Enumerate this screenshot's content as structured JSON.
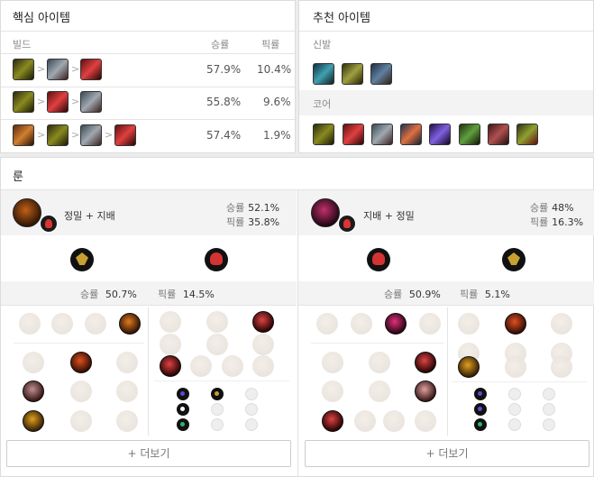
{
  "core": {
    "title": "핵심 아이템",
    "headers": {
      "build": "빌드",
      "winrate": "승률",
      "pickrate": "픽률"
    },
    "rows": [
      {
        "winrate": "57.9%",
        "pickrate": "10.4%"
      },
      {
        "winrate": "55.8%",
        "pickrate": "9.6%"
      },
      {
        "winrate": "57.4%",
        "pickrate": "1.9%"
      }
    ],
    "arrow": ">"
  },
  "recommended": {
    "title": "추천 아이템",
    "boots_label": "신발",
    "core_label": "코어"
  },
  "runes": {
    "title": "룬",
    "pages": [
      {
        "name": "정밀 + 지배",
        "winrate_label": "승률",
        "winrate": "52.1%",
        "pickrate_label": "픽률",
        "pickrate": "35.8%",
        "detail_winrate_label": "승률",
        "detail_winrate": "50.7%",
        "detail_pickrate_label": "픽률",
        "detail_pickrate": "14.5%",
        "more_label": "+ 더보기"
      },
      {
        "name": "지배 + 정밀",
        "winrate_label": "승률",
        "winrate": "48%",
        "pickrate_label": "픽률",
        "pickrate": "16.3%",
        "detail_winrate_label": "승률",
        "detail_winrate": "50.9%",
        "detail_pickrate_label": "픽률",
        "detail_pickrate": "5.1%",
        "more_label": "+ 더보기"
      }
    ]
  },
  "colors": {
    "accent_precision": "#c8a032",
    "accent_domination": "#d33333",
    "shard_purple": "#5a4bd6",
    "shard_green": "#2fb36b"
  }
}
